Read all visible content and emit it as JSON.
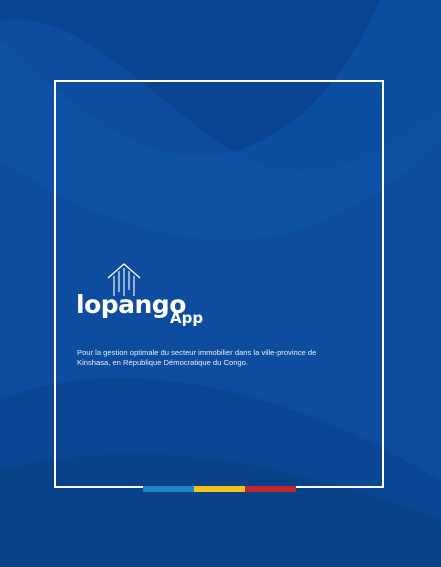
{
  "logo": {
    "icon": "house-icon",
    "wordmark": "lopango",
    "suffix": "App"
  },
  "tagline": {
    "line1": "Pour la gestion optimale du secteur immobilier dans la ville-province de",
    "line2": "Kinshasa, en République Démocratique du Congo."
  },
  "colors": {
    "background": "#0d4c9e",
    "frame": "#ffffff",
    "stripe_blue": "#1a86c9",
    "stripe_yellow": "#f2c41d",
    "stripe_red": "#c0272d"
  }
}
